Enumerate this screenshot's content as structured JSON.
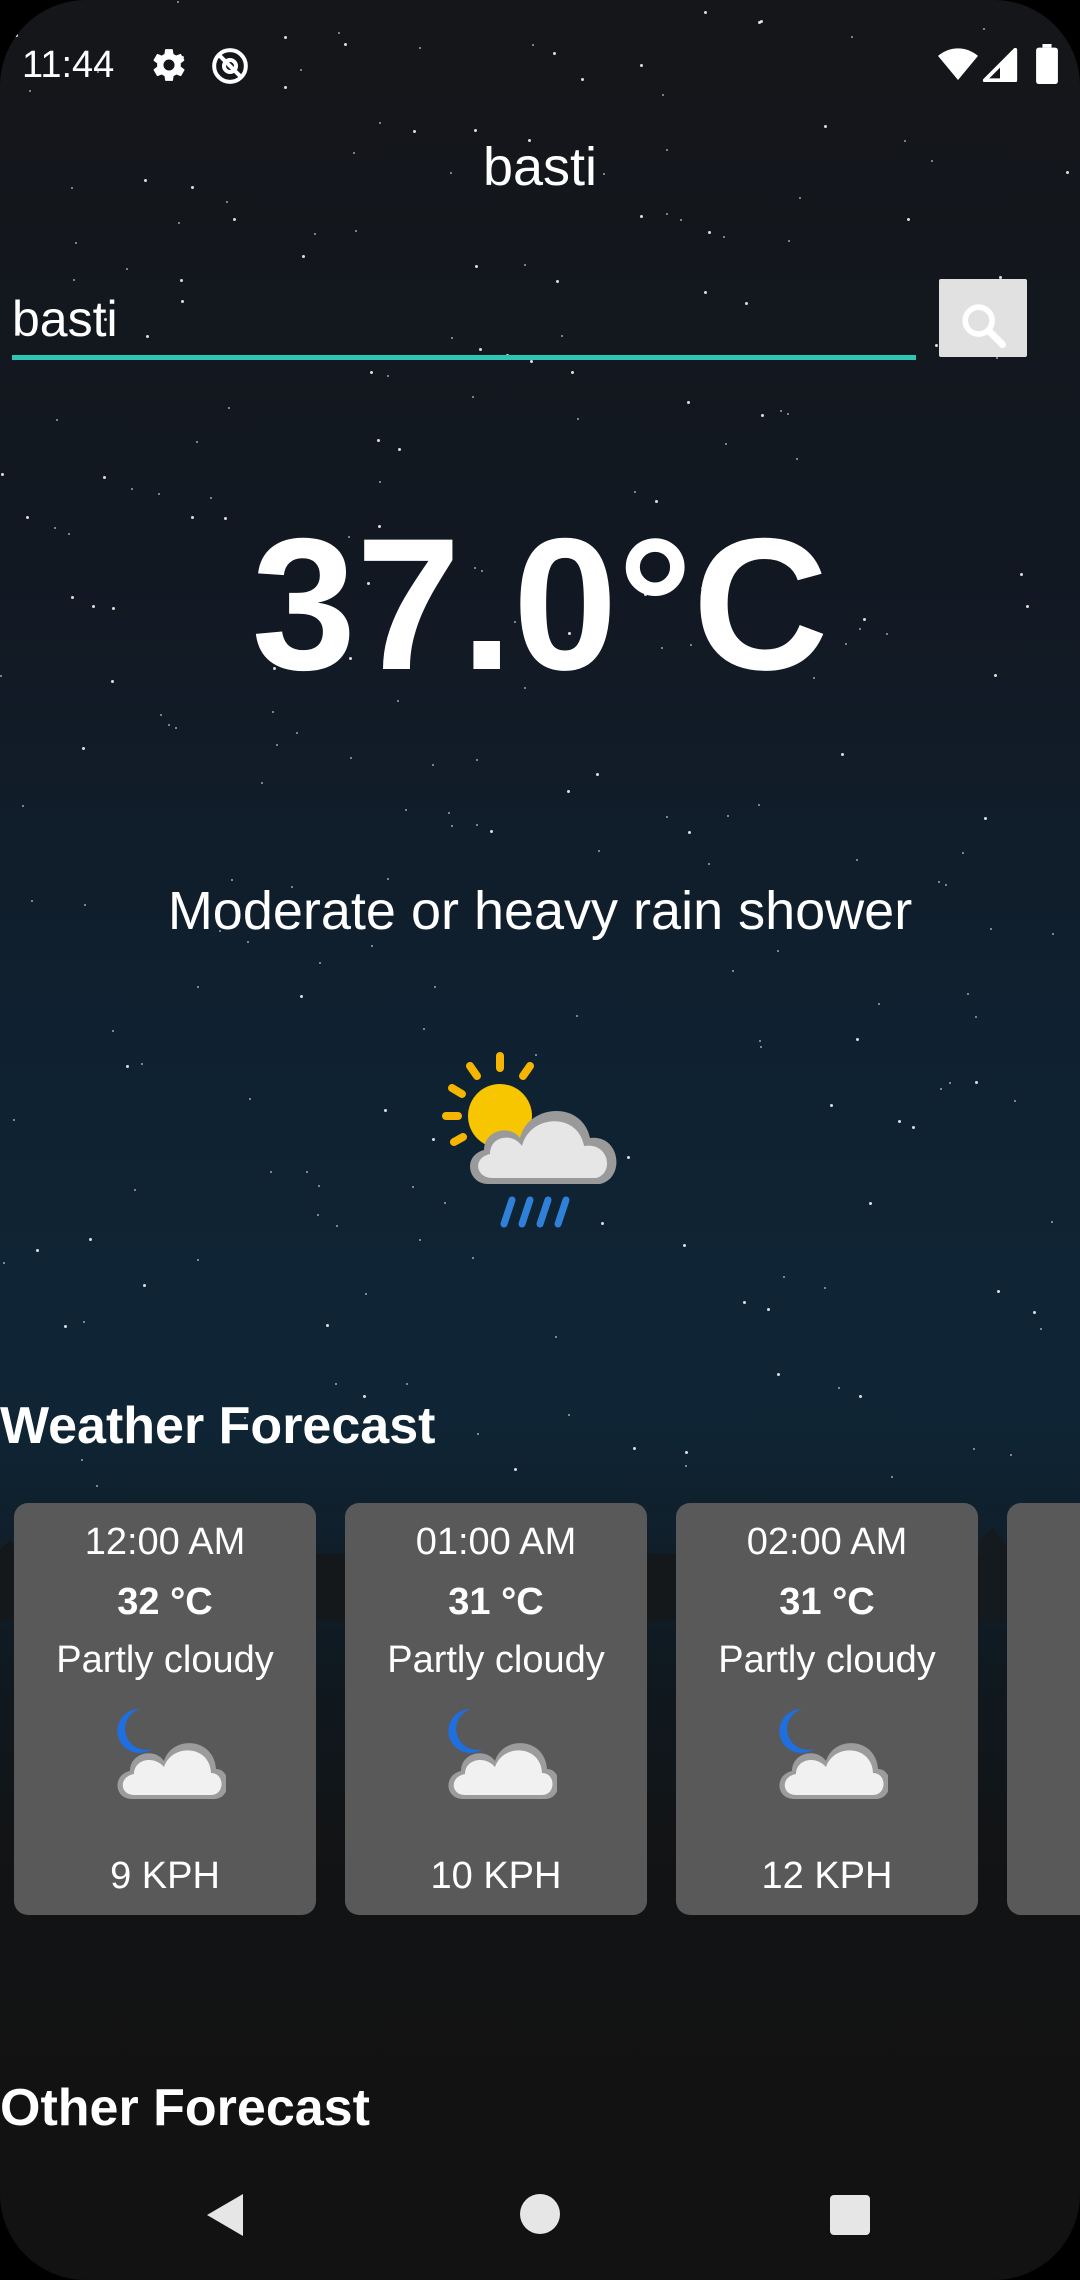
{
  "status_bar": {
    "time": "11:44",
    "icons": [
      "gear-icon",
      "at-sign-icon",
      "wifi-icon",
      "cellular-signal-icon",
      "battery-icon"
    ]
  },
  "header": {
    "city": "basti"
  },
  "search": {
    "value": "basti",
    "placeholder": "",
    "button_icon": "search-icon",
    "underline_color": "#2dc5b3"
  },
  "current": {
    "temperature": "37.0°C",
    "condition": "Moderate or heavy rain shower",
    "icon": "sun-cloud-rain-icon"
  },
  "sections": {
    "weather_forecast": "Weather Forecast",
    "other_forecast": "Other Forecast"
  },
  "forecast": [
    {
      "time": "12:00 AM",
      "temp": "32 °C",
      "condition": "Partly cloudy",
      "icon": "moon-cloud-icon",
      "wind": "9 KPH"
    },
    {
      "time": "01:00 AM",
      "temp": "31 °C",
      "condition": "Partly cloudy",
      "icon": "moon-cloud-icon",
      "wind": "10 KPH"
    },
    {
      "time": "02:00 AM",
      "temp": "31 °C",
      "condition": "Partly cloudy",
      "icon": "moon-cloud-icon",
      "wind": "12 KPH"
    },
    {
      "time": "",
      "temp": "",
      "condition": "",
      "icon": "",
      "wind": ""
    }
  ],
  "colors": {
    "card_bg": "#595959",
    "accent": "#2dc5b3"
  },
  "nav": {
    "icons": [
      "back-icon",
      "home-icon",
      "recents-icon"
    ]
  }
}
